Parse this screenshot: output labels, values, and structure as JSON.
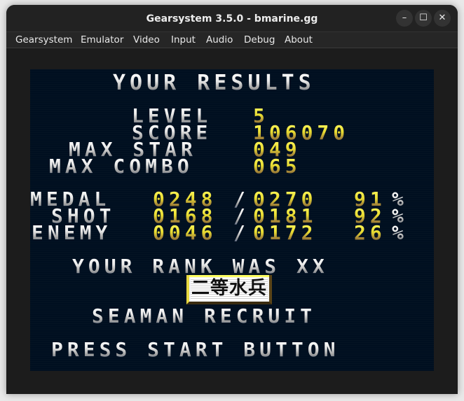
{
  "window": {
    "title": "Gearsystem 3.5.0 - bmarine.gg",
    "controls": {
      "minimize": "–",
      "maximize": "☐",
      "close": "✕"
    }
  },
  "menu": [
    "Gearsystem",
    "Emulator",
    "Video",
    "Input",
    "Audio",
    "Debug",
    "About"
  ],
  "game": {
    "heading": "YOUR RESULTS",
    "stats": [
      {
        "label": "LEVEL",
        "value": "5"
      },
      {
        "label": "SCORE",
        "value": "106070"
      },
      {
        "label": "MAX STAR",
        "value": "049"
      },
      {
        "label": "MAX COMBO",
        "value": "065"
      }
    ],
    "ratios": [
      {
        "label": "MEDAL",
        "hit": "0248",
        "total": "0270",
        "percent": "91",
        "percent_sign": "%"
      },
      {
        "label": "SHOT",
        "hit": "0168",
        "total": "0181",
        "percent": "92",
        "percent_sign": "%"
      },
      {
        "label": "ENEMY",
        "hit": "0046",
        "total": "0172",
        "percent": "26",
        "percent_sign": "%"
      }
    ],
    "ratio_separator": "/",
    "rank_line": "YOUR RANK WAS XX",
    "rank_kanji": "二等水兵",
    "rank_name": "SEAMAN RECRUIT",
    "prompt": "PRESS START BUTTON"
  }
}
